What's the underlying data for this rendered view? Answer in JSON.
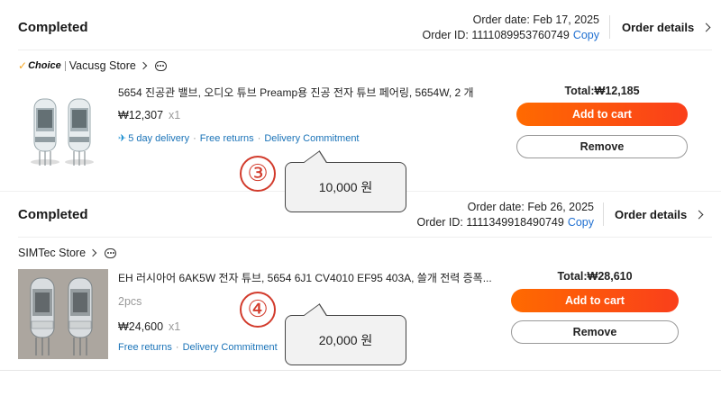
{
  "orders": [
    {
      "status": "Completed",
      "order_date": "Order date: Feb 17, 2025",
      "order_id": "Order ID: 1111089953760749",
      "copy_label": "Copy",
      "details_label": "Order details",
      "store_badge": "Choice",
      "store_name": "Vacusg Store",
      "item_title": "5654 진공관 밸브, 오디오 튜브 Preamp용 진공 전자 튜브 페어링, 5654W, 2 개",
      "price": "₩12,307",
      "quantity": "x1",
      "delivery": "5 day delivery",
      "free_returns": "Free returns",
      "commitment": "Delivery Commitment",
      "total": "Total:₩12,185",
      "add_to_cart": "Add to cart",
      "remove": "Remove"
    },
    {
      "status": "Completed",
      "order_date": "Order date: Feb 26, 2025",
      "order_id": "Order ID: 1111349918490749",
      "copy_label": "Copy",
      "details_label": "Order details",
      "store_name": "SIMTec Store",
      "item_title": "EH 러시아어 6AK5W 전자 튜브, 5654 6J1 CV4010 EF95 403A, 쓸개 전력 증폭...",
      "pack": "2pcs",
      "price": "₩24,600",
      "quantity": "x1",
      "free_returns": "Free returns",
      "commitment": "Delivery Commitment",
      "total": "Total:₩28,610",
      "add_to_cart": "Add to cart",
      "remove": "Remove"
    }
  ],
  "annotations": [
    {
      "marker": "③",
      "note": "10,000 원"
    },
    {
      "marker": "④",
      "note": "20,000 원"
    }
  ],
  "colors": {
    "accent": "#fa4b14",
    "link": "#1a73b8",
    "badge": "#d23b2c"
  }
}
